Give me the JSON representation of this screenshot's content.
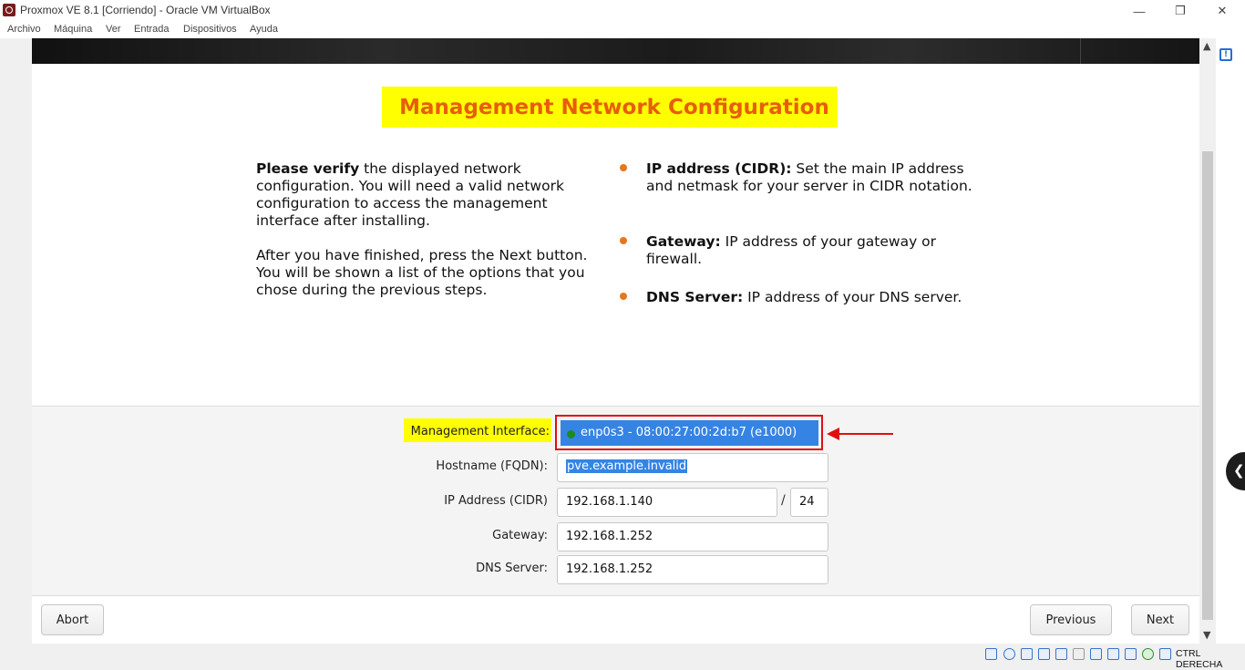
{
  "window": {
    "title": "Proxmox VE 8.1 [Corriendo] - Oracle VM VirtualBox",
    "controls": {
      "minimize": "—",
      "restore": "❐",
      "close": "✕"
    }
  },
  "menu": [
    "Archivo",
    "Máquina",
    "Ver",
    "Entrada",
    "Dispositivos",
    "Ayuda"
  ],
  "installer": {
    "heading": "Management Network Configuration",
    "left_text": {
      "p1_bold": "Please verify",
      "p1_rest": " the displayed network configuration. You will need a valid network configuration to access the management interface after installing.",
      "p2": "After you have finished, press the Next button. You will be shown a list of the options that you chose during the previous steps."
    },
    "bullets": [
      {
        "bold": "IP address (CIDR):",
        "text": " Set the main IP address and netmask for your server in CIDR notation."
      },
      {
        "bold": "Gateway:",
        "text": " IP address of your gateway or firewall."
      },
      {
        "bold": "DNS Server:",
        "text": " IP address of your DNS server."
      }
    ],
    "form": {
      "management_interface_label": "Management Interface:",
      "management_interface_value": "enp0s3 - 08:00:27:00:2d:b7 (e1000)",
      "hostname_label": "Hostname (FQDN):",
      "hostname_value": "pve.example.invalid",
      "ip_label": "IP Address (CIDR)",
      "ip_value": "192.168.1.140",
      "cidr_separator": "/",
      "netmask_value": "24",
      "gateway_label": "Gateway:",
      "gateway_value": "192.168.1.252",
      "dns_label": "DNS Server:",
      "dns_value": "192.168.1.252"
    },
    "buttons": {
      "abort": "Abort",
      "previous": "Previous",
      "next": "Next"
    }
  },
  "statusbar": {
    "host_key": "CTRL DERECHA",
    "icons": [
      "hard-disk-icon",
      "optical-drive-icon",
      "audio-icon",
      "network-icon",
      "usb-icon",
      "shared-folders-icon",
      "display-icon",
      "video-capture-icon",
      "virtualization-icon",
      "cpu-icon",
      "mouse-integration-icon"
    ]
  },
  "colors": {
    "heading": "#e85d0c",
    "highlight": "#ffff00",
    "selection": "#3584e4",
    "annotation": "#e01010"
  }
}
